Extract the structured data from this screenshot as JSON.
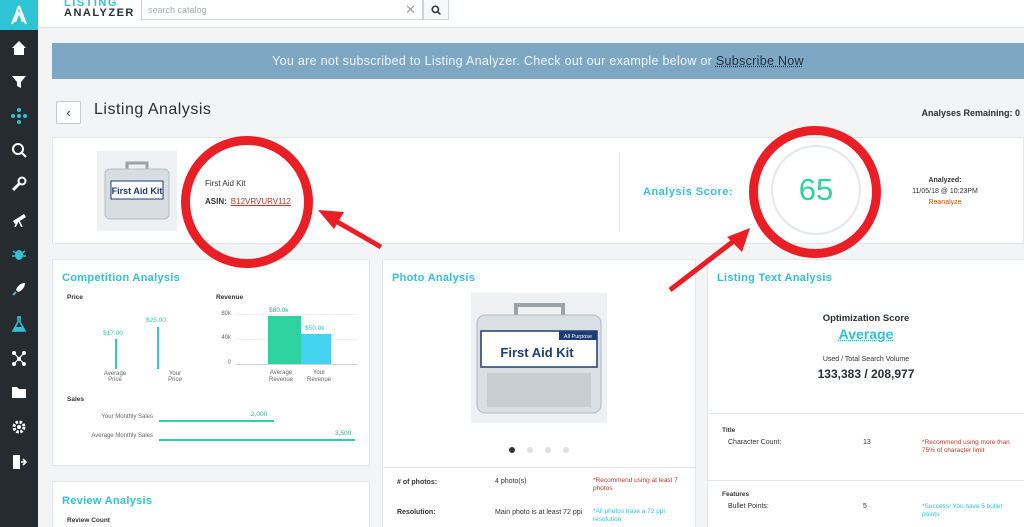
{
  "brand": {
    "line1": "LISTING",
    "line2": "ANALYZER"
  },
  "search": {
    "placeholder": "search catalog",
    "value": ""
  },
  "sidebar": {
    "items": [
      {
        "icon": "home-icon"
      },
      {
        "icon": "funnel-icon"
      },
      {
        "icon": "network-icon"
      },
      {
        "icon": "search-icon"
      },
      {
        "icon": "wrench-icon"
      },
      {
        "icon": "telescope-icon"
      },
      {
        "icon": "bug-icon"
      },
      {
        "icon": "rocket-icon"
      },
      {
        "icon": "flask-icon"
      },
      {
        "icon": "share-icon"
      },
      {
        "icon": "folder-icon"
      },
      {
        "icon": "gear-icon"
      },
      {
        "icon": "logout-icon"
      }
    ]
  },
  "banner": {
    "text": "You are not subscribed to Listing Analyzer. Check out our example below or ",
    "link": "Subscribe Now"
  },
  "header": {
    "back": "‹",
    "title": "Listing Analysis",
    "remaining": "Analyses Remaining: 0"
  },
  "product": {
    "name": "First Aid Kit",
    "asin_label": "ASIN:",
    "asin": "B12VRVURV112",
    "image_text": "First Aid Kit"
  },
  "score": {
    "label": "Analysis Score:",
    "value": "65",
    "analyzed_label": "Analyzed:",
    "analyzed_date": "11/05/18 @ 10:23PM",
    "reanalyze": "Reanalyze"
  },
  "competition": {
    "title": "Competition Analysis",
    "price_label": "Price",
    "price_avg": "$17.00",
    "price_yours": "$25.00",
    "price_avg_label": "Average\nPrice",
    "price_your_label": "Your\nPrice",
    "revenue_label": "Revenue",
    "rev_ticks": [
      "80k",
      "40k",
      "0"
    ],
    "rev_avg": "$80.0k",
    "rev_yours": "$50.0k",
    "rev_avg_label": "Average\nRevenue",
    "rev_your_label": "Your\nRevenue",
    "sales_label": "Sales",
    "your_sales_label": "Your Monthly Sales",
    "your_sales": "2,000",
    "avg_sales_label": "Average Monthly Sales",
    "avg_sales": "3,500"
  },
  "review": {
    "title": "Review Analysis",
    "count_label": "Review Count"
  },
  "photo": {
    "title": "Photo Analysis",
    "image_text": "First Aid Kit",
    "image_badge": "All Purpose",
    "rows": [
      {
        "label": "# of photos:",
        "value": "4 photo(s)",
        "note": "*Recommend using at least 7 photos",
        "note_color": "#c0392b"
      },
      {
        "label": "Resolution:",
        "value": "Main photo is at least 72 ppi",
        "note": "*All photos have a 72 ppi resolution",
        "note_color": "#2ec4d6"
      }
    ]
  },
  "listing_text": {
    "title": "Listing Text Analysis",
    "opt_label": "Optimization Score",
    "opt_value": "Average",
    "volume_label": "Used / Total Search Volume",
    "volume_value": "133,383 / 208,977",
    "sections": [
      {
        "heading": "Title",
        "row_label": "Character Count:",
        "row_value": "13",
        "note": "*Recommend using more than 75% of character limit",
        "note_color": "#c0392b"
      },
      {
        "heading": "Features",
        "row_label": "Bullet Points:",
        "row_value": "5",
        "note": "*Success! You have 5 bullet points",
        "note_color": "#2ec4d6"
      }
    ]
  },
  "colors": {
    "accent": "#2ec4d6",
    "score": "#2fd3a0",
    "annotation": "#ea1f26",
    "banner": "#7ea7c3"
  }
}
